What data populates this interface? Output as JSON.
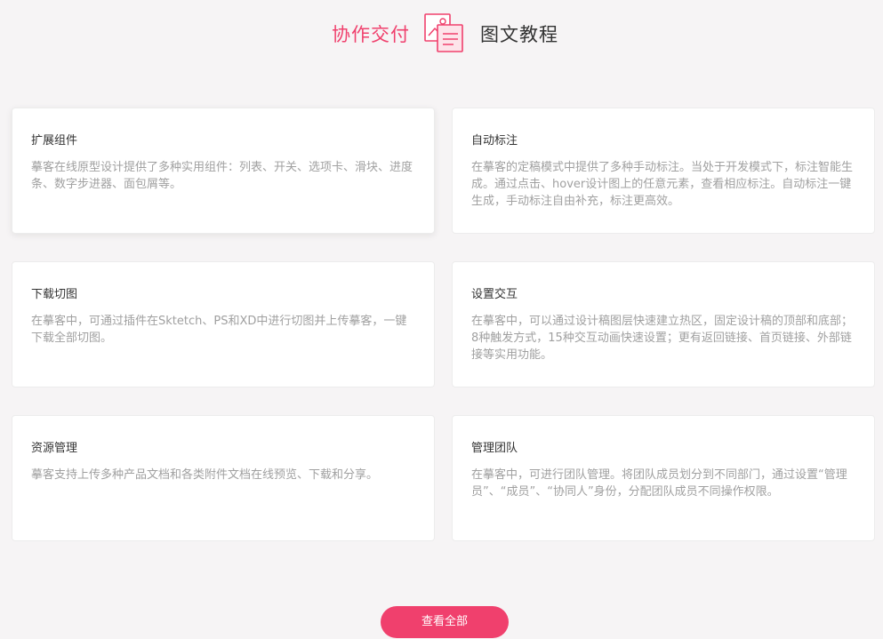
{
  "header": {
    "left_title": "协作交付",
    "right_title": "图文教程",
    "icon": "document-image-icon",
    "accent_color": "#f0406d"
  },
  "cards": [
    {
      "title": "扩展组件",
      "desc": "摹客在线原型设计提供了多种实用组件：列表、开关、选项卡、滑块、进度条、数字步进器、面包屑等。"
    },
    {
      "title": "自动标注",
      "desc": "在摹客的定稿模式中提供了多种手动标注。当处于开发模式下，标注智能生成。通过点击、hover设计图上的任意元素，查看相应标注。自动标注一键生成，手动标注自由补充，标注更高效。"
    },
    {
      "title": "下载切图",
      "desc": "在摹客中，可通过插件在Sktetch、PS和XD中进行切图并上传摹客，一键下载全部切图。"
    },
    {
      "title": "设置交互",
      "desc": "在摹客中，可以通过设计稿图层快速建立热区，固定设计稿的顶部和底部；8种触发方式，15种交互动画快速设置；更有返回链接、首页链接、外部链接等实用功能。"
    },
    {
      "title": "资源管理",
      "desc": "摹客支持上传多种产品文档和各类附件文档在线预览、下载和分享。"
    },
    {
      "title": "管理团队",
      "desc": "在摹客中，可进行团队管理。将团队成员划分到不同部门，通过设置“管理员”、“成员”、“协同人”身份，分配团队成员不同操作权限。"
    }
  ],
  "button": {
    "label": "查看全部"
  }
}
